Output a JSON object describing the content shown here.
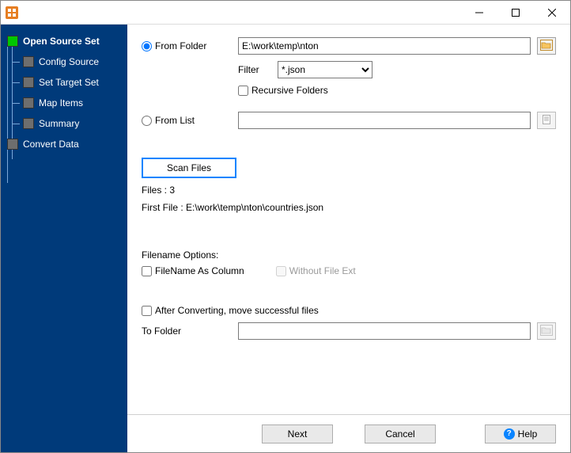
{
  "sidebar": {
    "items": [
      {
        "label": "Open Source Set",
        "active": true
      },
      {
        "label": "Config Source"
      },
      {
        "label": "Set Target Set"
      },
      {
        "label": "Map Items"
      },
      {
        "label": "Summary"
      },
      {
        "label": "Convert Data"
      }
    ]
  },
  "source": {
    "from_folder_label": "From Folder",
    "folder_path": "E:\\work\\temp\\nton",
    "filter_label": "Filter",
    "filter_value": "*.json",
    "recursive_label": "Recursive Folders",
    "from_list_label": "From List",
    "from_list_value": ""
  },
  "scan": {
    "button_label": "Scan Files",
    "files_count_label": "Files : 3",
    "first_file_label": "First File : E:\\work\\temp\\nton\\countries.json"
  },
  "filename_options": {
    "title": "Filename Options:",
    "as_column_label": "FileName As Column",
    "without_ext_label": "Without File Ext"
  },
  "after": {
    "move_label": "After Converting, move successful files",
    "to_folder_label": "To Folder",
    "to_folder_value": ""
  },
  "footer": {
    "next_label": "Next",
    "cancel_label": "Cancel",
    "help_label": "Help"
  }
}
